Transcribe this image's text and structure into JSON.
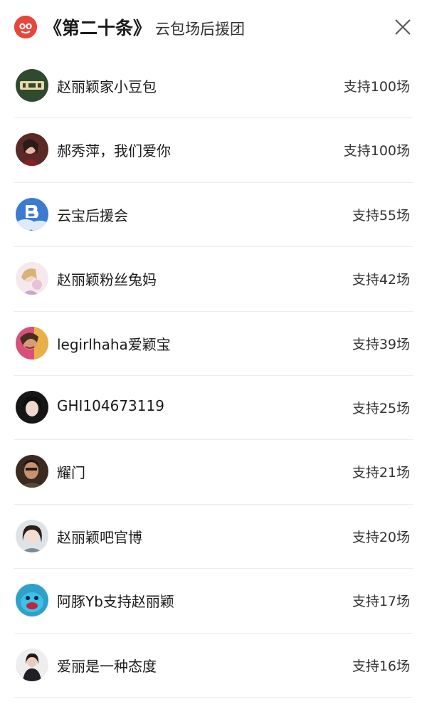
{
  "header": {
    "title": "《第二十条》",
    "subtitle": "云包场后援团",
    "logo_icon": "app-logo-icon",
    "close_icon": "close-icon",
    "accent_color": "#e8463a"
  },
  "list": [
    {
      "name": "赵丽颖家小豆包",
      "support": "支持100场",
      "avatar_icon": "avatar-logo-icon"
    },
    {
      "name": "郝秀萍，我们爱你",
      "support": "支持100场",
      "avatar_icon": "avatar-photo-icon"
    },
    {
      "name": "云宝后援会",
      "support": "支持55场",
      "avatar_icon": "avatar-logo-icon"
    },
    {
      "name": "赵丽颖粉丝兔妈",
      "support": "支持42场",
      "avatar_icon": "avatar-illustration-icon"
    },
    {
      "name": "legirlhaha爱颖宝",
      "support": "支持39场",
      "avatar_icon": "avatar-photo-icon"
    },
    {
      "name": "GHI104673119",
      "support": "支持25场",
      "avatar_icon": "avatar-photo-icon"
    },
    {
      "name": "耀门",
      "support": "支持21场",
      "avatar_icon": "avatar-photo-icon"
    },
    {
      "name": "赵丽颖吧官博",
      "support": "支持20场",
      "avatar_icon": "avatar-photo-icon"
    },
    {
      "name": "阿豚Yb支持赵丽颖",
      "support": "支持17场",
      "avatar_icon": "avatar-illustration-icon"
    },
    {
      "name": "爱丽是一种态度",
      "support": "支持16场",
      "avatar_icon": "avatar-photo-icon"
    }
  ]
}
